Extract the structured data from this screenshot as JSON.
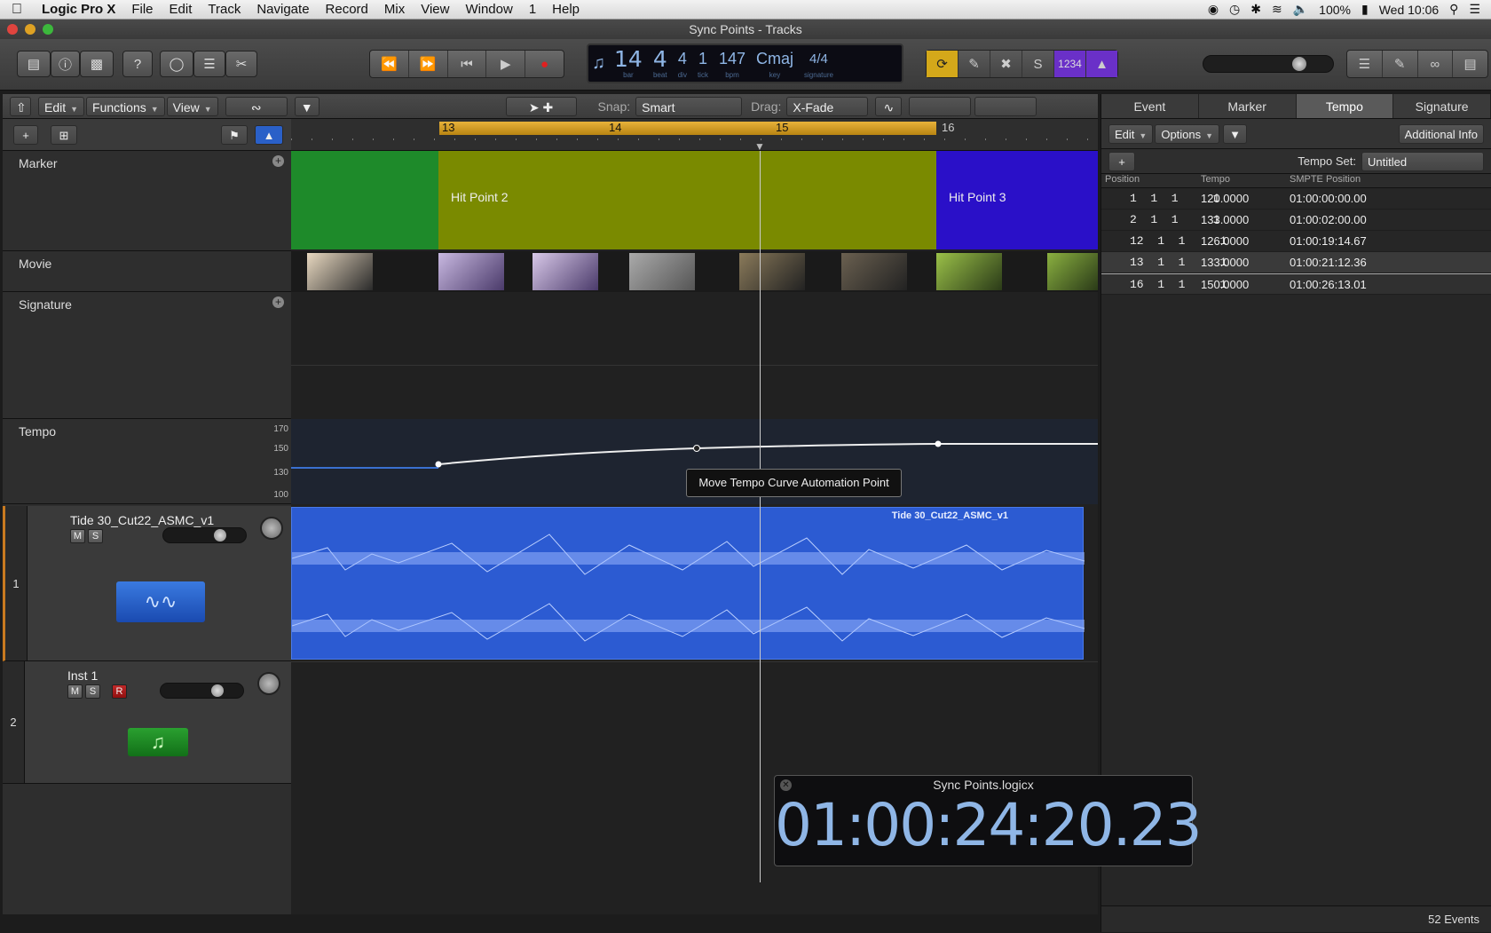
{
  "menubar": {
    "app": "Logic Pro X",
    "items": [
      "File",
      "Edit",
      "Track",
      "Navigate",
      "Record",
      "Mix",
      "View",
      "Window",
      "1",
      "Help"
    ],
    "battery": "100%",
    "clock": "Wed 10:06"
  },
  "window": {
    "title": "Sync Points - Tracks"
  },
  "lcd": {
    "bar": "14",
    "beat": "4",
    "div": "4",
    "tick": "1",
    "bpm": "147",
    "key": "Cmaj",
    "signature": "4/4",
    "bar_cap": "bar",
    "beat_cap": "beat",
    "div_cap": "div",
    "tick_cap": "tick",
    "bpm_cap": "bpm",
    "key_cap": "key",
    "sig_cap": "signature"
  },
  "toolbar_right": {
    "count_in": "1234"
  },
  "editbar": {
    "edit": "Edit",
    "functions": "Functions",
    "view": "View",
    "snap_label": "Snap:",
    "snap_value": "Smart",
    "drag_label": "Drag:",
    "drag_value": "X-Fade"
  },
  "ruler": {
    "bars": [
      "13",
      "14",
      "15",
      "16"
    ]
  },
  "globals": {
    "marker": "Marker",
    "movie": "Movie",
    "signature": "Signature",
    "tempo": "Tempo",
    "tempo_scale": [
      "170",
      "150",
      "130",
      "100"
    ]
  },
  "regions": {
    "hit2": "Hit Point 2",
    "hit3": "Hit Point 3",
    "audio_name": "Tide 30_Cut22_ASMC_v1"
  },
  "tracks": [
    {
      "num": "1",
      "name": "Tide 30_Cut22_ASMC_v1",
      "m": "M",
      "s": "S"
    },
    {
      "num": "2",
      "name": "Inst 1",
      "m": "M",
      "s": "S",
      "r": "R"
    }
  ],
  "tooltip": "Move Tempo Curve Automation Point",
  "sidepanel": {
    "tabs": [
      "Event",
      "Marker",
      "Tempo",
      "Signature"
    ],
    "edit": "Edit",
    "options": "Options",
    "additional": "Additional Info",
    "tempo_set_label": "Tempo Set:",
    "tempo_set_value": "Untitled",
    "cols": [
      "Position",
      "Tempo",
      "SMPTE Position"
    ],
    "rows": [
      {
        "pos": "1  1  1     1",
        "tempo": "120.0000",
        "smpte": "01:00:00:00.00"
      },
      {
        "pos": "2  1  1     1",
        "tempo": "133.0000",
        "smpte": "01:00:02:00.00"
      },
      {
        "pos": "12  1  1     1",
        "tempo": "126.0000",
        "smpte": "01:00:19:14.67"
      },
      {
        "pos": "13  1  1     1",
        "tempo": "133.0000",
        "smpte": "01:00:21:12.36"
      },
      {
        "pos": "16  1  1     1",
        "tempo": "150.0000",
        "smpte": "01:00:26:13.01"
      }
    ],
    "events": "52 Events"
  },
  "clock": {
    "title": "Sync Points.logicx",
    "time": "01:00:24:20.23"
  },
  "colors": {
    "marker1": "#1e8a2a",
    "marker2": "#7a8a00",
    "marker3": "#2a10c8",
    "audio": "#2c5bd2",
    "cycle": "#e0a830",
    "lcd_text": "#8fb6e6"
  }
}
